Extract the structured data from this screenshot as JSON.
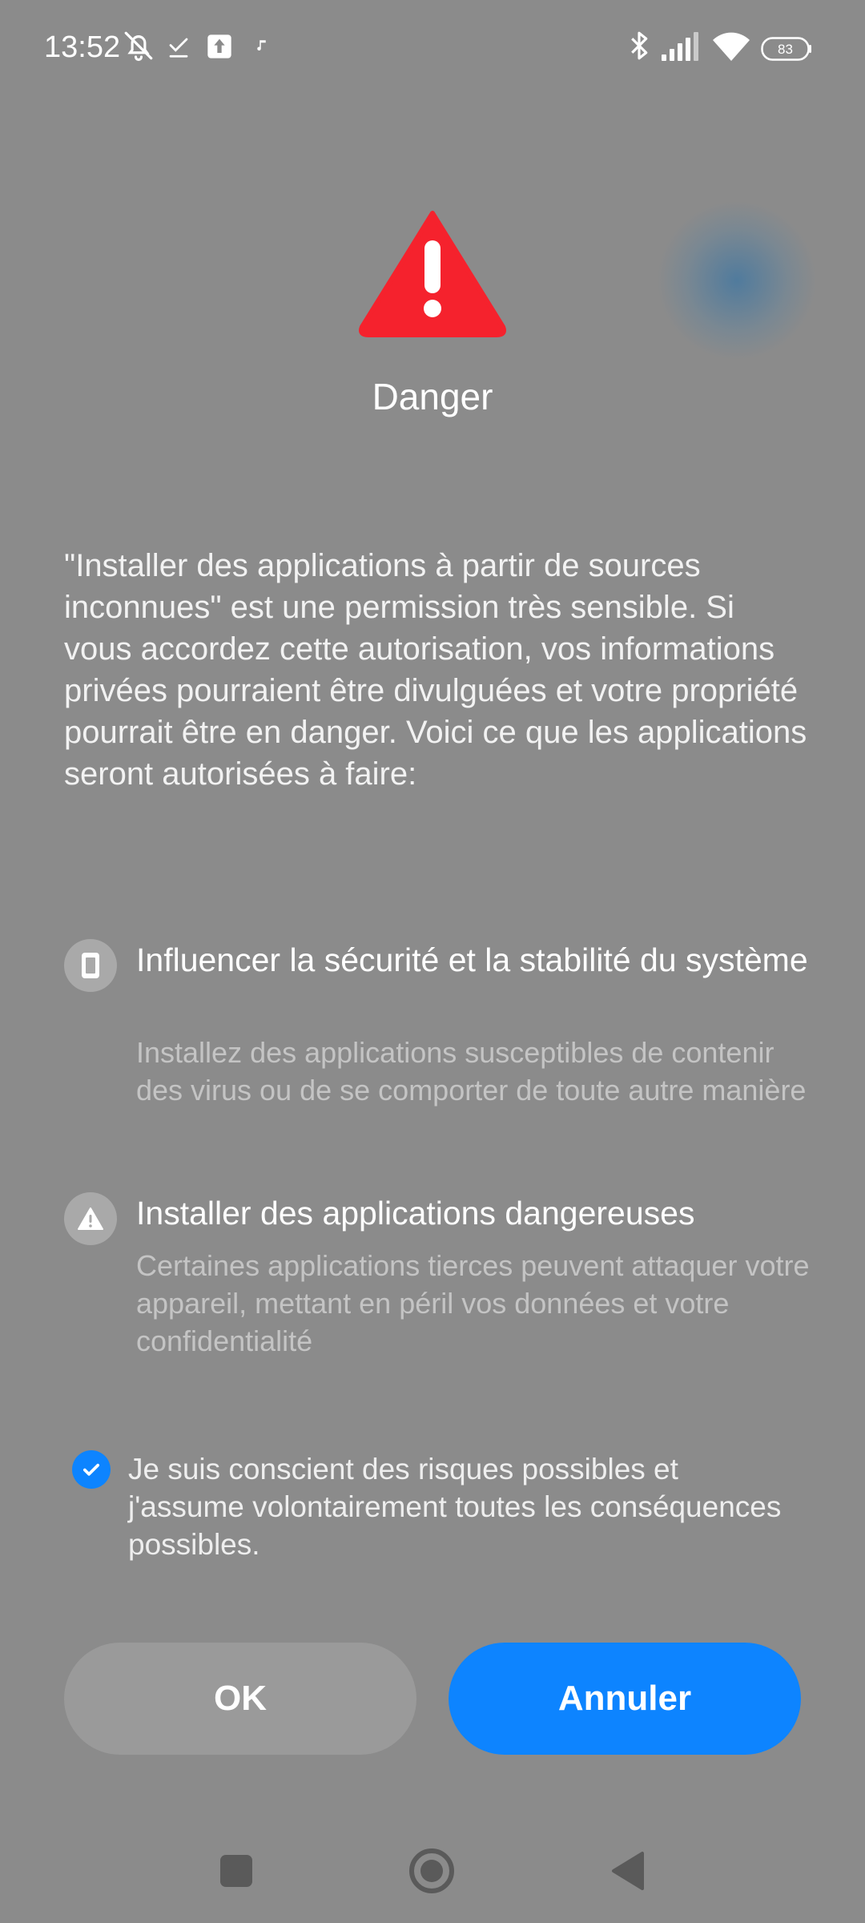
{
  "status_bar": {
    "time": "13:52",
    "battery_level": "83",
    "left_icons": [
      "bell-off-icon",
      "download-done-icon",
      "upload-icon",
      "music-note-icon"
    ],
    "right_icons": [
      "bluetooth-icon",
      "cellular-signal-icon",
      "wifi-icon",
      "battery-icon"
    ]
  },
  "dialog": {
    "title": "Danger",
    "title_icon": "warning-triangle-icon",
    "accent_color": "#f5222d",
    "description": "\"Installer des applications à partir de sources inconnues\" est une permission très sensible. Si vous accordez cette autorisation, vos informations privées pourraient être divulguées et votre propriété pourrait être en danger. Voici ce que les applications seront autorisées à faire:",
    "permissions": [
      {
        "icon": "phone-icon",
        "title": "Influencer la sécurité et la stabilité du système",
        "description": "Installez des applications susceptibles de contenir des virus ou de se comporter de toute autre manière"
      },
      {
        "icon": "warning-icon",
        "title": "Installer des applications dangereuses",
        "description": "Certaines applications tierces peuvent attaquer votre appareil, mettant en péril vos données et votre confidentialité"
      }
    ],
    "consent": {
      "checked": true,
      "text": "Je suis conscient des risques possibles et j'assume volontairement toutes les conséquences possibles."
    },
    "buttons": {
      "ok_label": "OK",
      "cancel_label": "Annuler",
      "primary_color": "#0d84ff"
    }
  },
  "nav_bar": {
    "icons": [
      "recents-square-icon",
      "home-circle-icon",
      "back-triangle-icon"
    ]
  }
}
